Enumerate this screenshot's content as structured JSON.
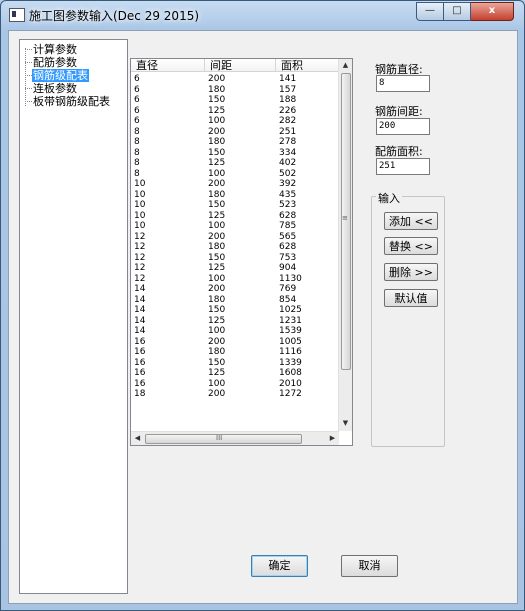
{
  "window": {
    "title": "施工图参数输入(Dec 29 2015)",
    "controls": {
      "minimize": "—",
      "maximize": "□",
      "close": "x"
    }
  },
  "tree": {
    "items": [
      {
        "label": "计算参数",
        "selected": false
      },
      {
        "label": "配筋参数",
        "selected": false
      },
      {
        "label": "钢筋级配表",
        "selected": true
      },
      {
        "label": "连板参数",
        "selected": false
      },
      {
        "label": "板带钢筋级配表",
        "selected": false
      }
    ]
  },
  "table": {
    "headers": [
      "直径",
      "间距",
      "面积"
    ],
    "rows": [
      [
        "6",
        "200",
        "141"
      ],
      [
        "6",
        "180",
        "157"
      ],
      [
        "6",
        "150",
        "188"
      ],
      [
        "6",
        "125",
        "226"
      ],
      [
        "6",
        "100",
        "282"
      ],
      [
        "8",
        "200",
        "251"
      ],
      [
        "8",
        "180",
        "278"
      ],
      [
        "8",
        "150",
        "334"
      ],
      [
        "8",
        "125",
        "402"
      ],
      [
        "8",
        "100",
        "502"
      ],
      [
        "10",
        "200",
        "392"
      ],
      [
        "10",
        "180",
        "435"
      ],
      [
        "10",
        "150",
        "523"
      ],
      [
        "10",
        "125",
        "628"
      ],
      [
        "10",
        "100",
        "785"
      ],
      [
        "12",
        "200",
        "565"
      ],
      [
        "12",
        "180",
        "628"
      ],
      [
        "12",
        "150",
        "753"
      ],
      [
        "12",
        "125",
        "904"
      ],
      [
        "12",
        "100",
        "1130"
      ],
      [
        "14",
        "200",
        "769"
      ],
      [
        "14",
        "180",
        "854"
      ],
      [
        "14",
        "150",
        "1025"
      ],
      [
        "14",
        "125",
        "1231"
      ],
      [
        "14",
        "100",
        "1539"
      ],
      [
        "16",
        "200",
        "1005"
      ],
      [
        "16",
        "180",
        "1116"
      ],
      [
        "16",
        "150",
        "1339"
      ],
      [
        "16",
        "125",
        "1608"
      ],
      [
        "16",
        "100",
        "2010"
      ],
      [
        "18",
        "200",
        "1272"
      ]
    ],
    "scroll_glyphs": {
      "up": "▲",
      "down": "▼",
      "left": "◀",
      "right": "▶",
      "grip_v": "≡",
      "grip_h": "III"
    }
  },
  "fields": {
    "diameter": {
      "label": "钢筋直径:",
      "value": "8"
    },
    "spacing": {
      "label": "钢筋间距:",
      "value": "200"
    },
    "area": {
      "label": "配筋面积:",
      "value": "251"
    }
  },
  "input_group": {
    "title": "输入",
    "buttons": {
      "add": "添加 <<",
      "replace": "替换 <>",
      "delete": "删除 >>",
      "default": "默认值"
    }
  },
  "footer": {
    "ok": "确定",
    "cancel": "取消"
  }
}
